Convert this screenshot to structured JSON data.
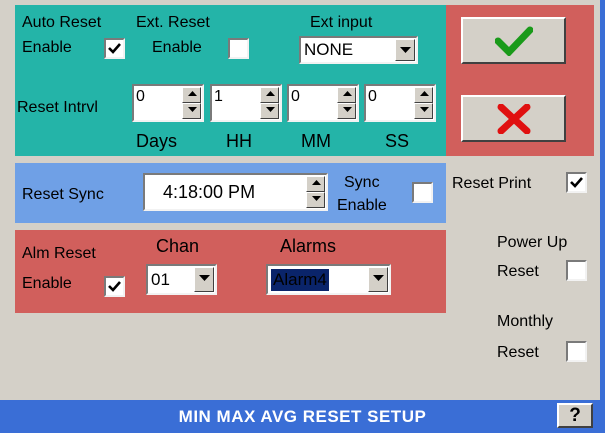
{
  "auto_reset": {
    "line1": "Auto Reset",
    "line2": "Enable",
    "checked": true
  },
  "ext_reset": {
    "line1": "Ext. Reset",
    "line2": "Enable",
    "checked": false
  },
  "ext_input": {
    "label": "Ext input",
    "value": "NONE"
  },
  "reset_interval": {
    "label": "Reset Intrvl",
    "fields": [
      {
        "value": "0",
        "unit": "Days"
      },
      {
        "value": "1",
        "unit": "HH"
      },
      {
        "value": "0",
        "unit": "MM"
      },
      {
        "value": "0",
        "unit": "SS"
      }
    ]
  },
  "reset_sync": {
    "label": "Reset Sync",
    "time": "4:18:00 PM",
    "sync_line1": "Sync",
    "sync_line2": "Enable",
    "sync_checked": false
  },
  "alm_reset": {
    "line1": "Alm Reset",
    "line2": "Enable",
    "checked": true,
    "chan_label": "Chan",
    "chan_value": "01",
    "alarms_label": "Alarms",
    "alarms_value": "Alarm4"
  },
  "reset_print": {
    "label": "Reset Print",
    "checked": true
  },
  "power_up": {
    "line1": "Power Up",
    "line2": "Reset",
    "checked": false
  },
  "monthly": {
    "line1": "Monthly",
    "line2": "Reset",
    "checked": false
  },
  "footer": {
    "title": "MIN MAX AVG RESET SETUP",
    "help": "?"
  },
  "colors": {
    "teal": "#24b4a8",
    "blue": "#6fa0e6",
    "red": "#d15f5c",
    "title_bar": "#3a6ed6",
    "ok_green": "#1a9a1a",
    "cancel_red": "#e01010"
  },
  "icons": {
    "ok": "checkmark-icon",
    "cancel": "x-icon"
  }
}
